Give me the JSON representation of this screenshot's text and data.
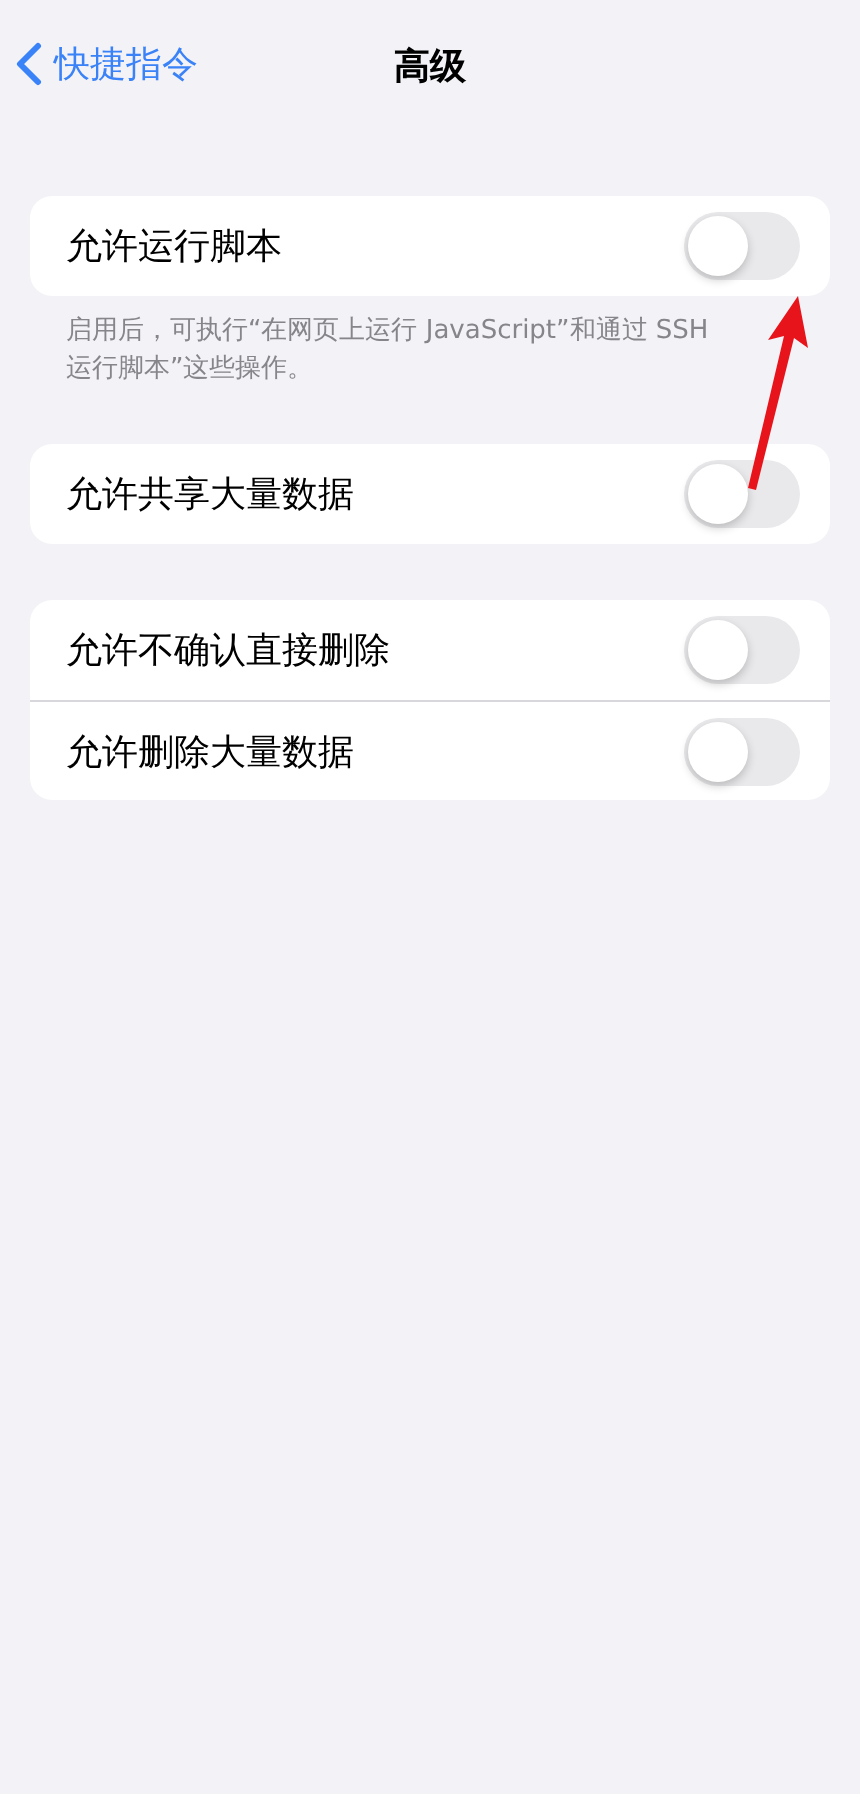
{
  "nav": {
    "back_label": "快捷指令",
    "title": "高级"
  },
  "groups": [
    {
      "rows": [
        {
          "label": "允许运行脚本",
          "on": false
        }
      ],
      "footer": "启用后，可执行“在网页上运行 JavaScript”和通过 SSH运行脚本”这些操作。"
    },
    {
      "rows": [
        {
          "label": "允许共享大量数据",
          "on": false
        }
      ]
    },
    {
      "rows": [
        {
          "label": "允许不确认直接删除",
          "on": false
        },
        {
          "label": "允许删除大量数据",
          "on": false
        }
      ]
    }
  ]
}
